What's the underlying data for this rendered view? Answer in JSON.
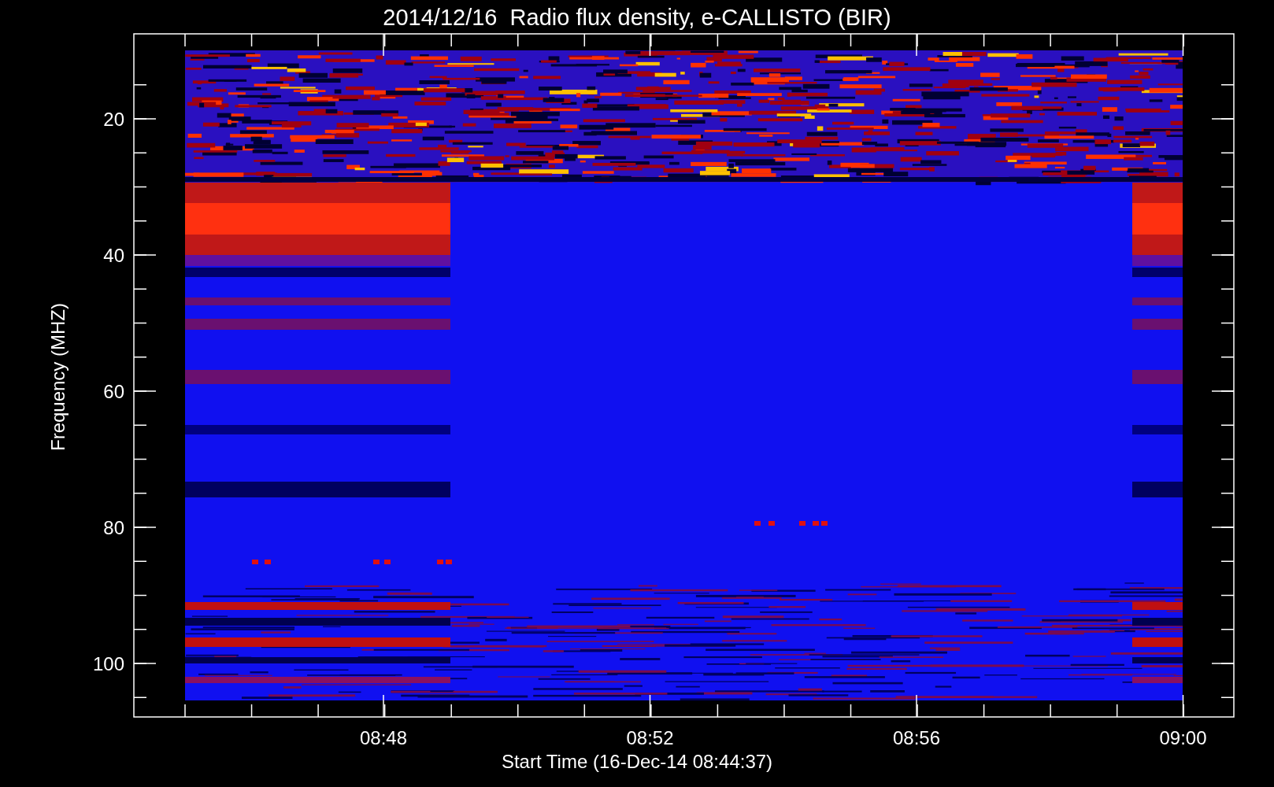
{
  "title": "2014/12/16  Radio flux density, e-CALLISTO (BIR)",
  "y_axis": {
    "label": "Frequency (MHZ)",
    "ticks": [
      "20",
      "40",
      "60",
      "80",
      "100"
    ]
  },
  "x_axis": {
    "label": "Start Time (16-Dec-14 08:44:37)",
    "ticks": [
      "08:48",
      "08:52",
      "08:56",
      "09:00"
    ]
  }
}
